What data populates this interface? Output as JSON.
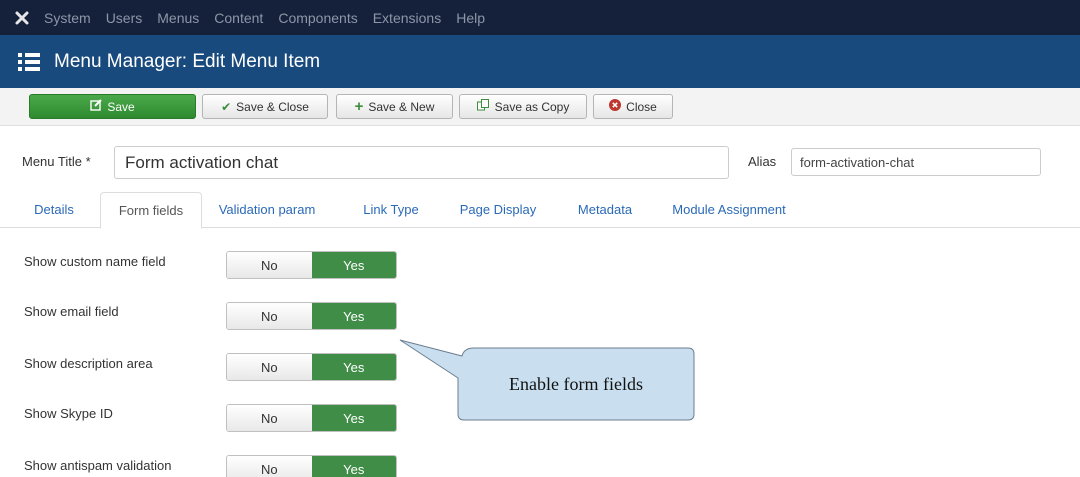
{
  "topnav": {
    "logo_icon": "joomla-logo-icon",
    "items": [
      "System",
      "Users",
      "Menus",
      "Content",
      "Components",
      "Extensions",
      "Help"
    ]
  },
  "titlebar": {
    "icon": "list-icon",
    "title": "Menu Manager: Edit Menu Item"
  },
  "toolbar": {
    "save": "Save",
    "save_close": "Save & Close",
    "save_new": "Save & New",
    "save_copy": "Save as Copy",
    "close": "Close"
  },
  "form": {
    "title_label": "Menu Title *",
    "title_value": "Form activation chat",
    "alias_label": "Alias",
    "alias_value": "form-activation-chat"
  },
  "tabs": [
    "Details",
    "Form fields",
    "Validation param",
    "Link Type",
    "Page Display",
    "Metadata",
    "Module Assignment"
  ],
  "active_tab": "Form fields",
  "fields": [
    {
      "label": "Show custom name field",
      "no": "No",
      "yes": "Yes",
      "value": "Yes"
    },
    {
      "label": "Show email field",
      "no": "No",
      "yes": "Yes",
      "value": "Yes"
    },
    {
      "label": "Show description area",
      "no": "No",
      "yes": "Yes",
      "value": "Yes"
    },
    {
      "label": "Show Skype ID",
      "no": "No",
      "yes": "Yes",
      "value": "Yes"
    },
    {
      "label": "Show antispam validation",
      "no": "No",
      "yes": "Yes",
      "value": "Yes"
    }
  ],
  "callout": {
    "text": "Enable form fields"
  },
  "colors": {
    "topnav_bg": "#15213a",
    "titlebar_bg": "#184a7d",
    "save_green": "#3d983d",
    "toggle_yes": "#3f8d47",
    "link_blue": "#2a69b8",
    "callout_fill": "#c9dff0"
  }
}
